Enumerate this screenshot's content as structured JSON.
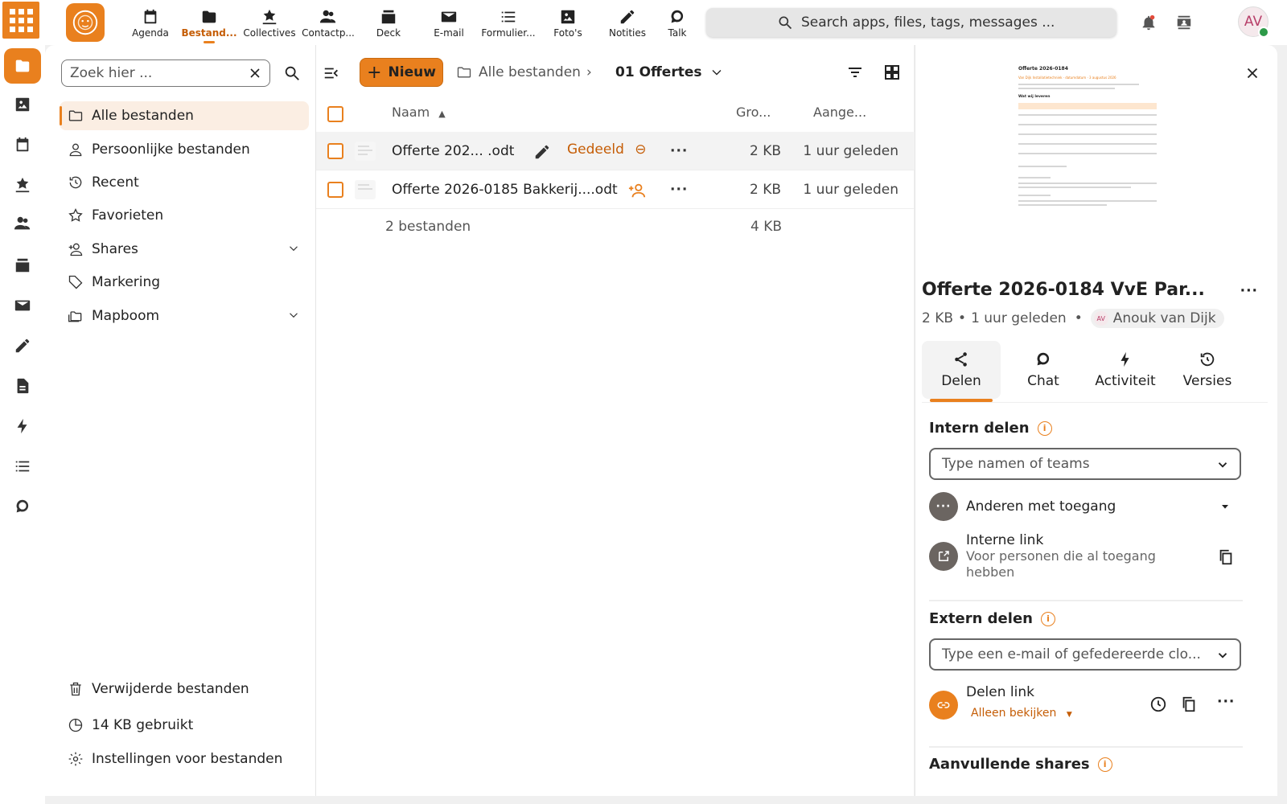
{
  "topbar": {
    "apps": [
      {
        "label": "Agenda",
        "icon": "calendar-icon"
      },
      {
        "label": "Bestand...",
        "icon": "folder-icon",
        "active": true
      },
      {
        "label": "Collectives",
        "icon": "collectives-icon"
      },
      {
        "label": "Contactp...",
        "icon": "contacts-icon"
      },
      {
        "label": "Deck",
        "icon": "deck-icon"
      },
      {
        "label": "E-mail",
        "icon": "mail-icon"
      },
      {
        "label": "Formulier...",
        "icon": "forms-icon"
      },
      {
        "label": "Foto's",
        "icon": "photos-icon"
      },
      {
        "label": "Notities",
        "icon": "pencil-icon"
      },
      {
        "label": "Talk",
        "icon": "talk-icon"
      }
    ],
    "search_placeholder": "Search apps, files, tags, messages ...",
    "avatar_initials": "AV",
    "accent": "#e9801e"
  },
  "sidebar": {
    "search_placeholder": "Zoek hier ...",
    "items": [
      {
        "label": "Alle bestanden",
        "icon": "folder-icon",
        "active": true
      },
      {
        "label": "Persoonlijke bestanden",
        "icon": "user-icon"
      },
      {
        "label": "Recent",
        "icon": "history-icon"
      },
      {
        "label": "Favorieten",
        "icon": "star-icon"
      },
      {
        "label": "Shares",
        "icon": "share-user-icon",
        "expandable": true
      },
      {
        "label": "Markering",
        "icon": "tag-icon"
      },
      {
        "label": "Mapboom",
        "icon": "folders-icon",
        "expandable": true
      }
    ],
    "footer": {
      "trash": "Verwijderde bestanden",
      "quota": "14 KB gebruikt",
      "settings": "Instellingen voor bestanden"
    }
  },
  "main": {
    "new_label": "Nieuw",
    "breadcrumb": {
      "root": "Alle bestanden",
      "current": "01 Offertes"
    },
    "columns": {
      "name": "Naam",
      "size": "Gro...",
      "modified": "Aange..."
    },
    "files": [
      {
        "name": "Offerte 202...  .odt",
        "shared_label": "Gedeeld",
        "size": "2 KB",
        "modified": "1 uur geleden"
      },
      {
        "name": "Offerte 2026-0185 Bakkerij....odt",
        "size": "2 KB",
        "modified": "1 uur geleden"
      }
    ],
    "summary": {
      "count": "2 bestanden",
      "total_size": "4 KB"
    }
  },
  "panel": {
    "preview": {
      "title": "Offerte 2026-0184",
      "subtitle": "Van Dijk Installatietechniek · datumdatum · 3 augustus 2026",
      "heading": "Wat wij leveren"
    },
    "title": "Offerte 2026-0184 VvE Par...",
    "meta": {
      "size": "2 KB",
      "modified": "1 uur geleden",
      "owner": "Anouk van Dijk",
      "owner_initials": "AV"
    },
    "tabs": [
      {
        "label": "Delen",
        "icon": "share-icon",
        "active": true
      },
      {
        "label": "Chat",
        "icon": "chat-icon"
      },
      {
        "label": "Activiteit",
        "icon": "bolt-icon"
      },
      {
        "label": "Versies",
        "icon": "restore-icon"
      }
    ],
    "internal": {
      "heading": "Intern delen",
      "placeholder": "Type namen of teams",
      "others_label": "Anderen met toegang",
      "link_title": "Interne link",
      "link_sub": "Voor personen die al toegang hebben"
    },
    "external": {
      "heading": "Extern delen",
      "placeholder": "Type een e-mail of gefedereerde clo...",
      "link_title": "Delen link",
      "link_perm": "Alleen bekijken"
    },
    "additional": {
      "heading": "Aanvullende shares"
    }
  }
}
